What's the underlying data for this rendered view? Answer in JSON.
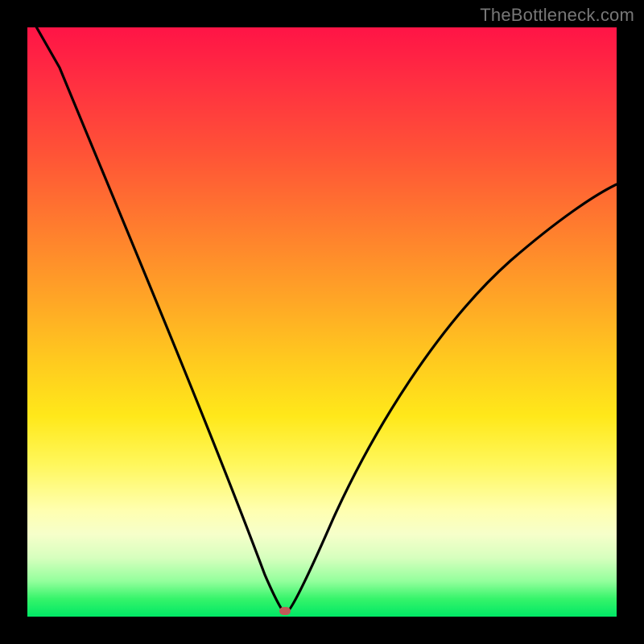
{
  "watermark": {
    "text": "TheBottleneck.com"
  },
  "chart_data": {
    "type": "line",
    "title": "",
    "xlabel": "",
    "ylabel": "",
    "xlim": [
      0,
      100
    ],
    "ylim": [
      0,
      100
    ],
    "series": [
      {
        "name": "bottleneck-curve",
        "x": [
          4,
          10,
          20,
          30,
          38,
          42,
          43,
          44,
          48,
          56,
          66,
          78,
          90,
          100
        ],
        "values": [
          100,
          84,
          60,
          38,
          18,
          7,
          2,
          0,
          8,
          26,
          46,
          62,
          72,
          78
        ]
      }
    ],
    "marker": {
      "x": 44,
      "y": 1,
      "color": "#c05a58"
    },
    "background_gradient": {
      "direction": "vertical",
      "stops": [
        {
          "pos": 0,
          "color": "#ff1446"
        },
        {
          "pos": 22,
          "color": "#ff5536"
        },
        {
          "pos": 46,
          "color": "#ffa526"
        },
        {
          "pos": 66,
          "color": "#ffe81a"
        },
        {
          "pos": 86,
          "color": "#f6ffca"
        },
        {
          "pos": 100,
          "color": "#00e765"
        }
      ]
    }
  }
}
